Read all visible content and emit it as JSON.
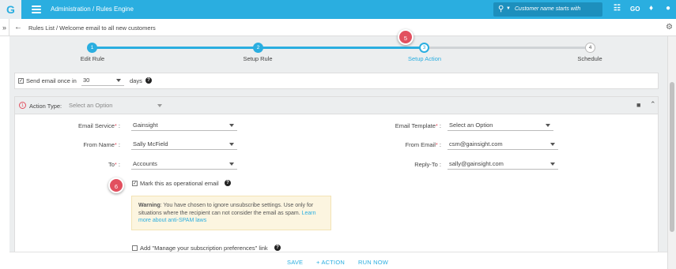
{
  "header": {
    "logo_letter": "G",
    "title": "Administration / Rules Engine",
    "search_placeholder": "Customer name starts with",
    "go_label": "GO"
  },
  "breadcrumb": {
    "text": "Rules List  /  Welcome email to all new customers"
  },
  "stepper": {
    "steps": [
      {
        "number": "1",
        "label": "Edit Rule"
      },
      {
        "number": "2",
        "label": "Setup Rule"
      },
      {
        "number": "3",
        "label": "Setup Action"
      },
      {
        "number": "4",
        "label": "Schedule"
      }
    ]
  },
  "callouts": {
    "step5": "5",
    "step6": "6"
  },
  "send_email": {
    "label": "Send email once in",
    "value": "30",
    "unit": "days"
  },
  "action": {
    "number": "1",
    "type_label": "Action Type:",
    "type_placeholder": "Select an Option"
  },
  "fields": {
    "email_service_label": "Email Service",
    "email_service_value": "Gainsight",
    "from_name_label": "From Name",
    "from_name_value": "Sally McField",
    "to_label": "To",
    "to_value": "Accounts",
    "email_template_label": "Email Template",
    "email_template_value": "Select an Option",
    "from_email_label": "From Email",
    "from_email_value": "csm@gainsight.com",
    "reply_to_label": "Reply-To",
    "reply_to_value": "sally@gainsight.com"
  },
  "operational": {
    "label": "Mark this as operational email"
  },
  "warning": {
    "title": "Warning",
    "text": ": You have chosen to ignore unsubscribe settings. Use only for situations where the recipient can not consider the email as spam.",
    "link": "Learn more about anti-SPAM laws"
  },
  "subscription": {
    "label": "Add \"Manage your subscription preferences\" link"
  },
  "footer": {
    "save": "SAVE",
    "add_action": "+ ACTION",
    "run_now": "RUN NOW"
  },
  "colors": {
    "brand": "#2aaee0",
    "callout": "#e2505f",
    "warning_bg": "#fcf5e0"
  }
}
